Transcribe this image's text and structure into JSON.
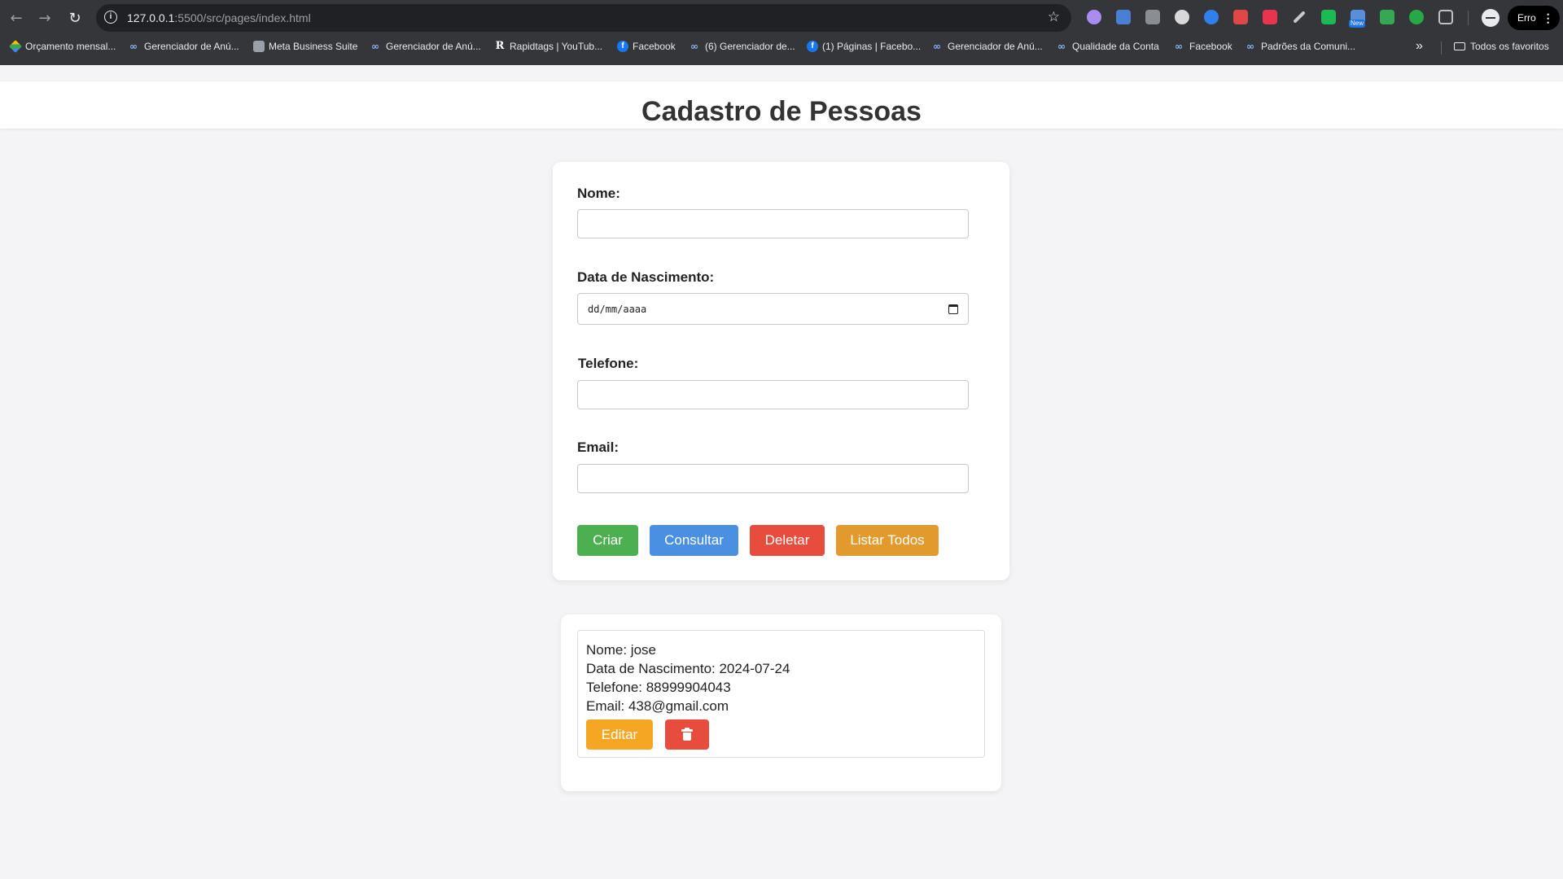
{
  "browser": {
    "url_host": "127.0.0.1",
    "url_path": ":5500/src/pages/index.html",
    "profile_status": "Erro",
    "extension_badge": "New",
    "bookmarks": [
      {
        "label": "Orçamento mensal...",
        "icon": "drive-icon"
      },
      {
        "label": "Gerenciador de Anú...",
        "icon": "meta-icon"
      },
      {
        "label": "Meta Business Suite",
        "icon": "meta-business-suite-icon"
      },
      {
        "label": "Gerenciador de Anú...",
        "icon": "meta-icon"
      },
      {
        "label": "Rapidtags | YouTub...",
        "icon": "rapidtags-icon"
      },
      {
        "label": "Facebook",
        "icon": "facebook-icon"
      },
      {
        "label": "(6) Gerenciador de...",
        "icon": "meta-icon"
      },
      {
        "label": "(1) Páginas | Facebo...",
        "icon": "facebook-icon"
      },
      {
        "label": "Gerenciador de Anú...",
        "icon": "meta-icon"
      },
      {
        "label": "Qualidade da Conta",
        "icon": "meta-icon"
      },
      {
        "label": "Facebook",
        "icon": "meta-icon"
      },
      {
        "label": "Padrões da Comuni...",
        "icon": "meta-icon"
      }
    ],
    "all_bookmarks_label": "Todos os favoritos"
  },
  "page": {
    "title": "Cadastro de Pessoas"
  },
  "form": {
    "nome_label": "Nome:",
    "nome_value": "",
    "nascimento_label": "Data de Nascimento:",
    "nascimento_placeholder": "dd/mm/aaaa",
    "telefone_label": "Telefone:",
    "telefone_value": "",
    "email_label": "Email:",
    "email_value": "",
    "buttons": {
      "criar": "Criar",
      "consultar": "Consultar",
      "deletar": "Deletar",
      "listar": "Listar Todos"
    }
  },
  "results": [
    {
      "nome": "Nome: jose",
      "nascimento": "Data de Nascimento: 2024-07-24",
      "telefone": "Telefone: 88999904043",
      "email": "Email: 438@gmail.com",
      "edit_label": "Editar"
    }
  ],
  "colors": {
    "criar": "#4caf50",
    "consultar": "#4a90e2",
    "deletar": "#e74c3c",
    "listar": "#e39a2c",
    "editar": "#f5a623",
    "excluir": "#e74c3c"
  }
}
